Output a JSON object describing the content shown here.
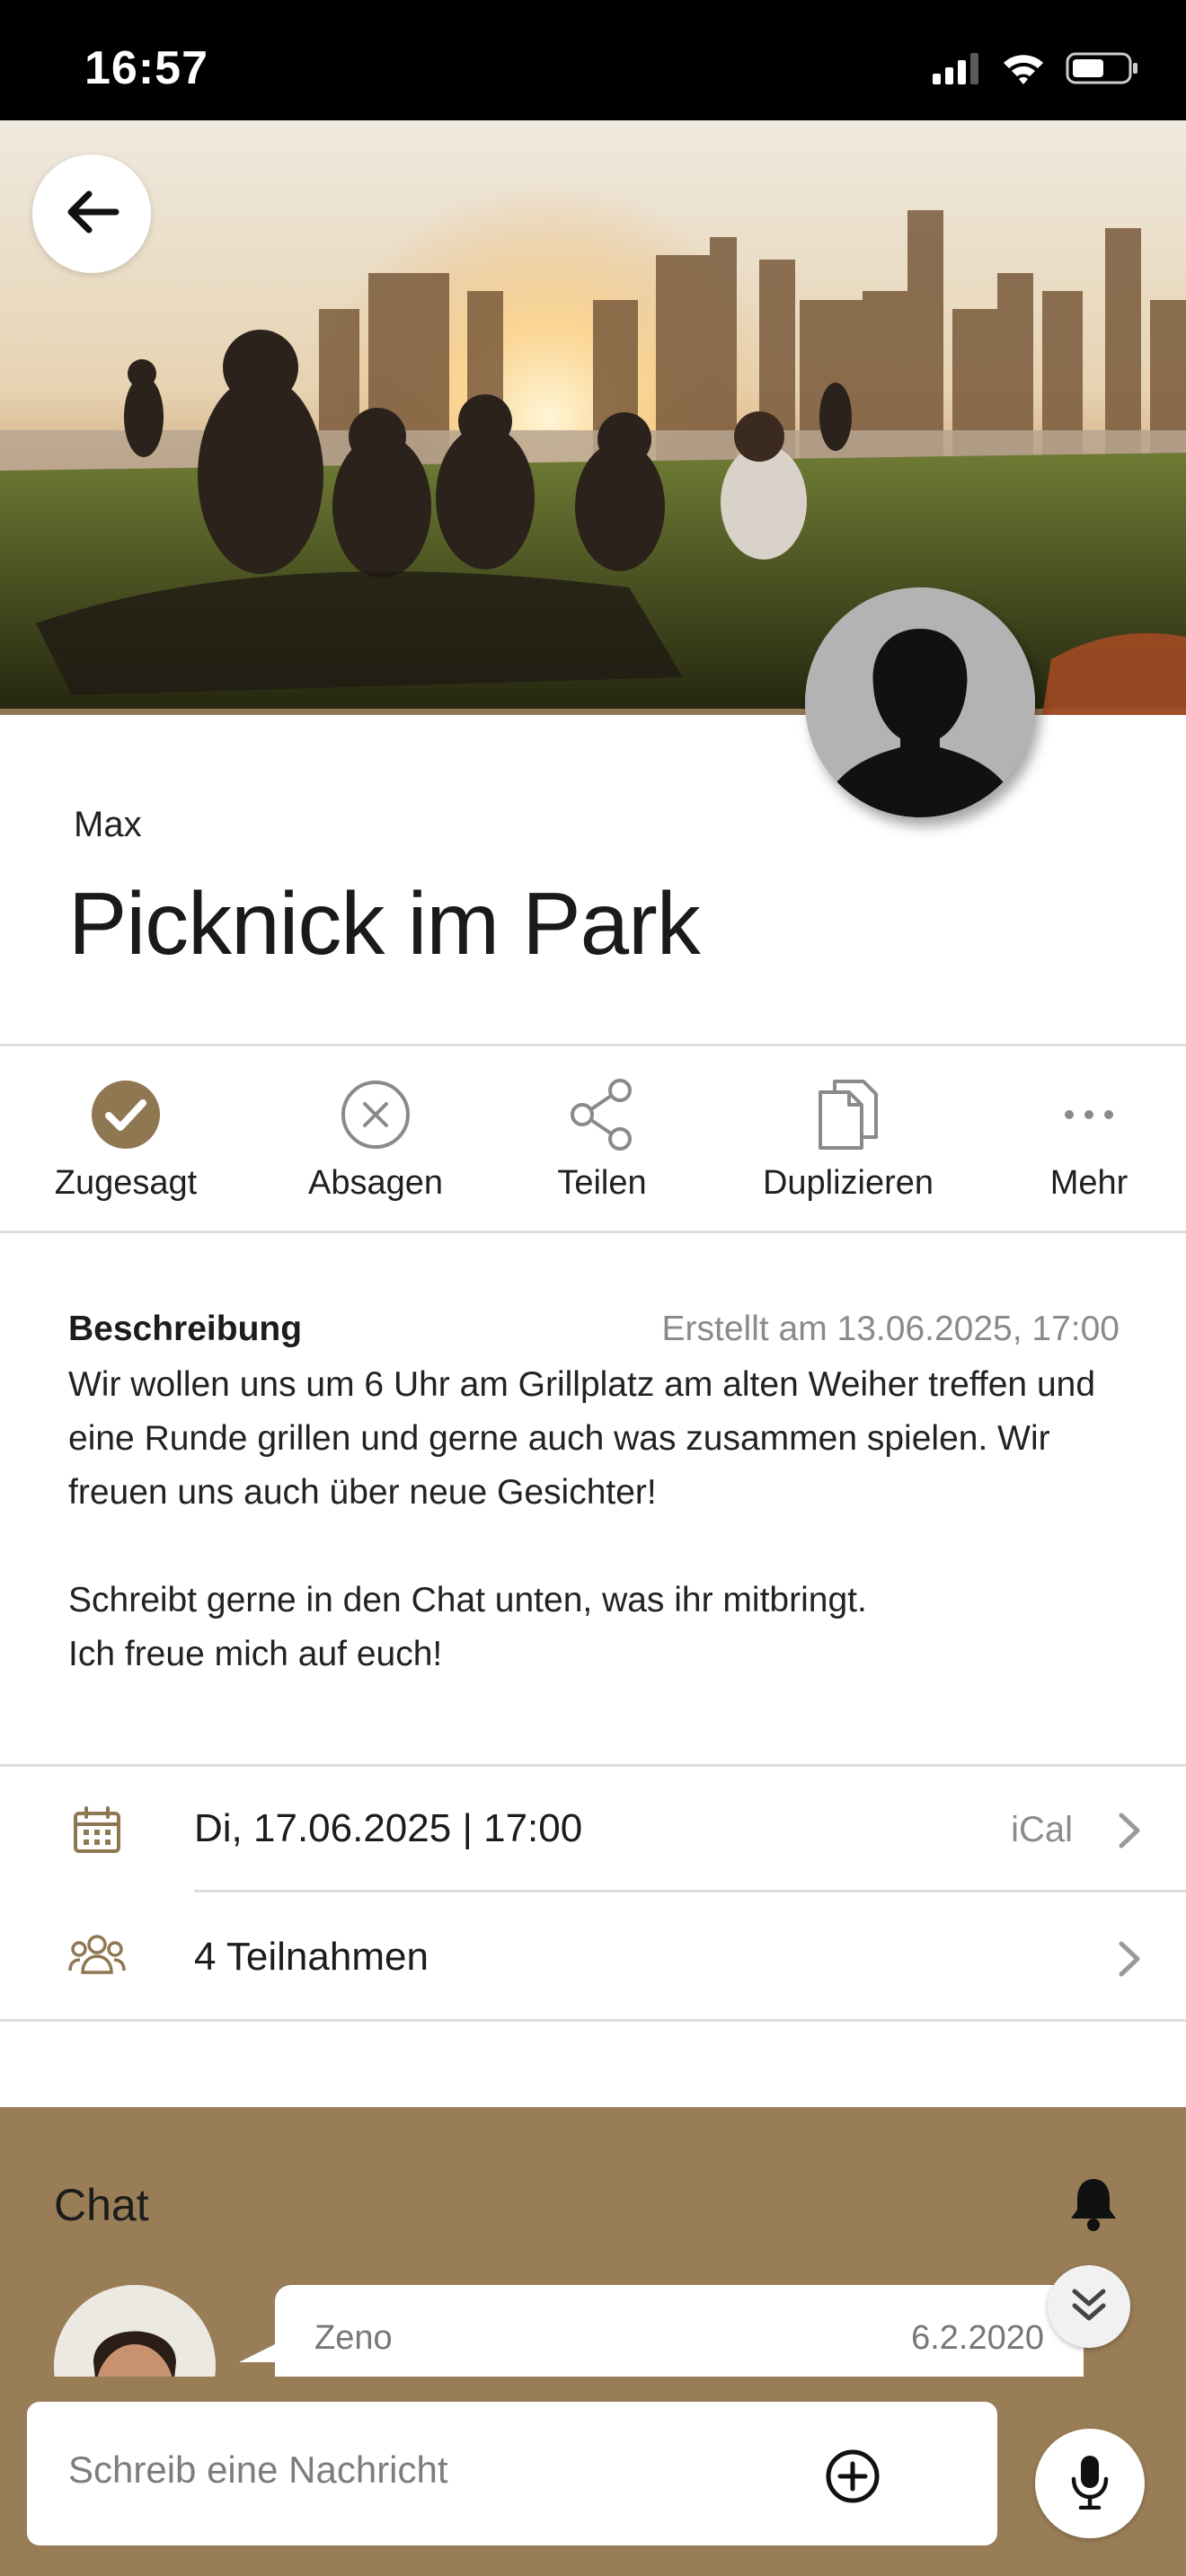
{
  "status_bar": {
    "time": "16:57",
    "icons": [
      "cellular-signal-icon",
      "wifi-icon",
      "battery-icon"
    ]
  },
  "header": {
    "back_icon": "arrow-left-icon",
    "hero_image": "city-skyline-picnic-photo",
    "organizer_avatar": "person-silhouette-icon"
  },
  "event": {
    "organizer": "Max",
    "title": "Picknick im Park"
  },
  "actions": [
    {
      "label": "Zugesagt",
      "icon": "check-circle-filled-icon",
      "active": true
    },
    {
      "label": "Absagen",
      "icon": "x-circle-icon"
    },
    {
      "label": "Teilen",
      "icon": "share-icon"
    },
    {
      "label": "Duplizieren",
      "icon": "copy-icon"
    },
    {
      "label": "Mehr",
      "icon": "more-dots-icon"
    }
  ],
  "description": {
    "heading": "Beschreibung",
    "created": "Erstellt am 13.06.2025, 17:00",
    "lines": [
      "Wir wollen uns um 6 Uhr am Grillplatz am alten Weiher treffen und",
      "eine Runde grillen und gerne auch was zusammen spielen. Wir",
      "freuen uns auch über neue Gesichter!",
      "",
      "Schreibt gerne in den Chat unten, was ihr mitbringt.",
      "Ich freue mich auf euch!"
    ]
  },
  "info_rows": {
    "date": {
      "text": "Di, 17.06.2025 | 17:00",
      "extra": "iCal",
      "icon": "calendar-icon"
    },
    "participants": {
      "text": "4 Teilnahmen",
      "icon": "group-icon"
    }
  },
  "chat": {
    "title": "Chat",
    "bell_icon": "bell-icon",
    "scroll_icon": "double-chevron-down-icon",
    "messages": [
      {
        "author": "Zeno",
        "date": "6.2.2020",
        "avatar": "user-photo"
      }
    ]
  },
  "composer": {
    "placeholder": "Schreib eine Nachricht",
    "add_icon": "plus-circle-icon",
    "mic_icon": "microphone-icon"
  },
  "colors": {
    "accent": "#8f7752",
    "chat_background": "#987d57",
    "divider": "#dedede",
    "muted_text": "#8a8a8a"
  }
}
